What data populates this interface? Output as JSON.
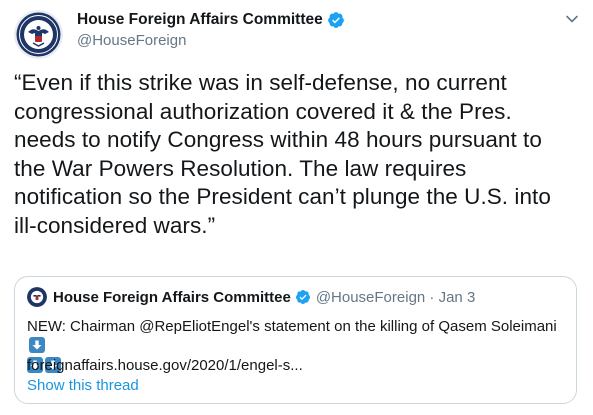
{
  "author": {
    "name": "House Foreign Affairs Committee",
    "handle": "@HouseForeign"
  },
  "tweet": {
    "lines": [
      "“Even if this strike was in self-defense, no current",
      "congressional authorization covered it & the Pres.",
      "needs to notify Congress within 48 hours pursuant to",
      "the War Powers Resolution. The law requires",
      "notification so the President can’t plunge the U.S. into",
      "ill-considered wars.”"
    ]
  },
  "quote": {
    "name": "House Foreign Affairs Committee",
    "meta": "@HouseForeign · Jan 3",
    "text": "NEW: Chairman @RepEliotEngel's statement on the killing of Qasem Soleimani",
    "link": "foreignaffairs.house.gov/2020/1/engel-s...",
    "show_thread": "Show this thread"
  },
  "colors": {
    "verified": "#1da1f2",
    "link": "#1b95e0",
    "secondary_text": "#657786",
    "border": "#ccd6dd",
    "seal_navy": "#1f3566",
    "emoji_blue": "#3b88c3"
  },
  "icons": [
    "seal-avatar-icon",
    "verified-badge-icon",
    "chevron-down-icon",
    "down-arrow-emoji-icon"
  ]
}
